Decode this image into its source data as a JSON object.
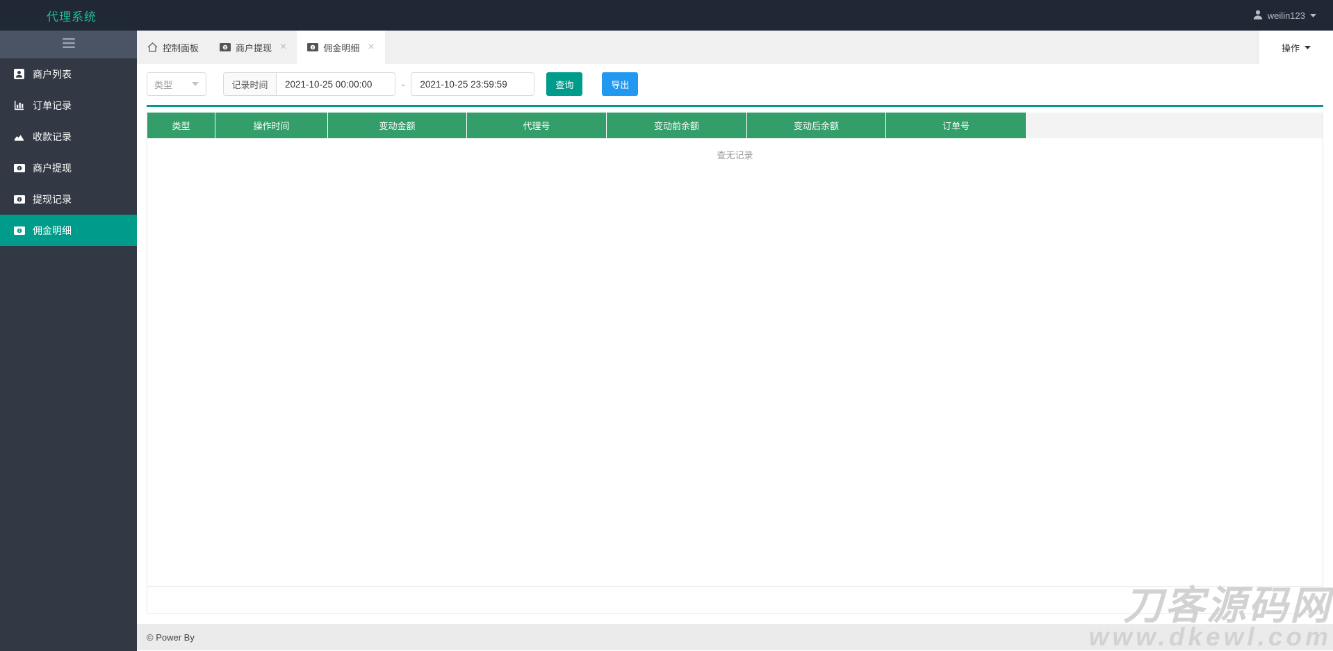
{
  "colors": {
    "accent_teal": "#009c8b",
    "header_green": "#349e6a",
    "export_blue": "#2298f1",
    "brand_green": "#1dbc9c"
  },
  "header": {
    "brand": "代理系统",
    "user": {
      "name": "weilin123",
      "icon": "user-icon"
    }
  },
  "sidebar": {
    "items": [
      {
        "label": "商户列表",
        "icon": "user-card-icon",
        "active": false
      },
      {
        "label": "订单记录",
        "icon": "bar-chart-icon",
        "active": false
      },
      {
        "label": "收款记录",
        "icon": "area-chart-icon",
        "active": false
      },
      {
        "label": "商户提现",
        "icon": "banknote-icon",
        "active": false
      },
      {
        "label": "提现记录",
        "icon": "banknote-icon",
        "active": false
      },
      {
        "label": "佣金明细",
        "icon": "banknote-icon",
        "active": true
      }
    ]
  },
  "tabs": [
    {
      "label": "控制面板",
      "icon": "home-icon",
      "closable": false,
      "active": false
    },
    {
      "label": "商户提现",
      "icon": "banknote-icon",
      "closable": true,
      "active": false
    },
    {
      "label": "佣金明细",
      "icon": "banknote-icon",
      "closable": true,
      "active": true
    }
  ],
  "actions_menu": {
    "label": "操作"
  },
  "filters": {
    "type_select": {
      "value": "类型"
    },
    "time_label": "记录时间",
    "time_from": "2021-10-25 00:00:00",
    "separator": "-",
    "time_to": "2021-10-25 23:59:59",
    "search_button": "查询",
    "export_button": "导出"
  },
  "table": {
    "columns": [
      "类型",
      "操作时间",
      "变动金额",
      "代理号",
      "变动前余额",
      "变动后余额",
      "订单号"
    ],
    "rows": [],
    "empty_text": "查无记录"
  },
  "footer": {
    "copyright": "© Power By"
  },
  "watermark": {
    "line1": "刀客源码网",
    "line2": "www.dkewl.com"
  }
}
